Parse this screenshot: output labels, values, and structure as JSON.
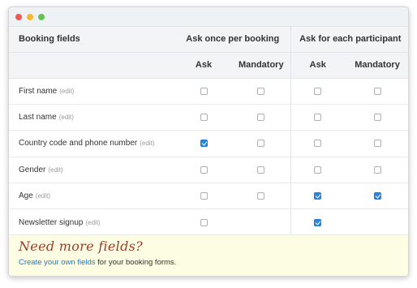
{
  "window": {
    "dot_colors": [
      "#ee5a52",
      "#f5b930",
      "#62c454"
    ]
  },
  "table": {
    "header": {
      "fields": "Booking fields",
      "group_once": "Ask once per booking",
      "group_each": "Ask for each participant",
      "ask": "Ask",
      "mandatory": "Mandatory"
    },
    "edit_label": "(edit)",
    "rows": [
      {
        "name": "First name",
        "once_ask": false,
        "once_mandatory": false,
        "each_ask": false,
        "each_mandatory": false
      },
      {
        "name": "Last name",
        "once_ask": false,
        "once_mandatory": false,
        "each_ask": false,
        "each_mandatory": false
      },
      {
        "name": "Country code and phone number",
        "once_ask": true,
        "once_mandatory": false,
        "each_ask": false,
        "each_mandatory": false
      },
      {
        "name": "Gender",
        "once_ask": false,
        "once_mandatory": false,
        "each_ask": false,
        "each_mandatory": false
      },
      {
        "name": "Age",
        "once_ask": false,
        "once_mandatory": false,
        "each_ask": true,
        "each_mandatory": true
      },
      {
        "name": "Newsletter signup",
        "once_ask": false,
        "once_mandatory": null,
        "each_ask": true,
        "each_mandatory": null
      }
    ]
  },
  "promo": {
    "title": "Need more fields?",
    "link": "Create your own fields",
    "suffix": " for your booking forms."
  }
}
